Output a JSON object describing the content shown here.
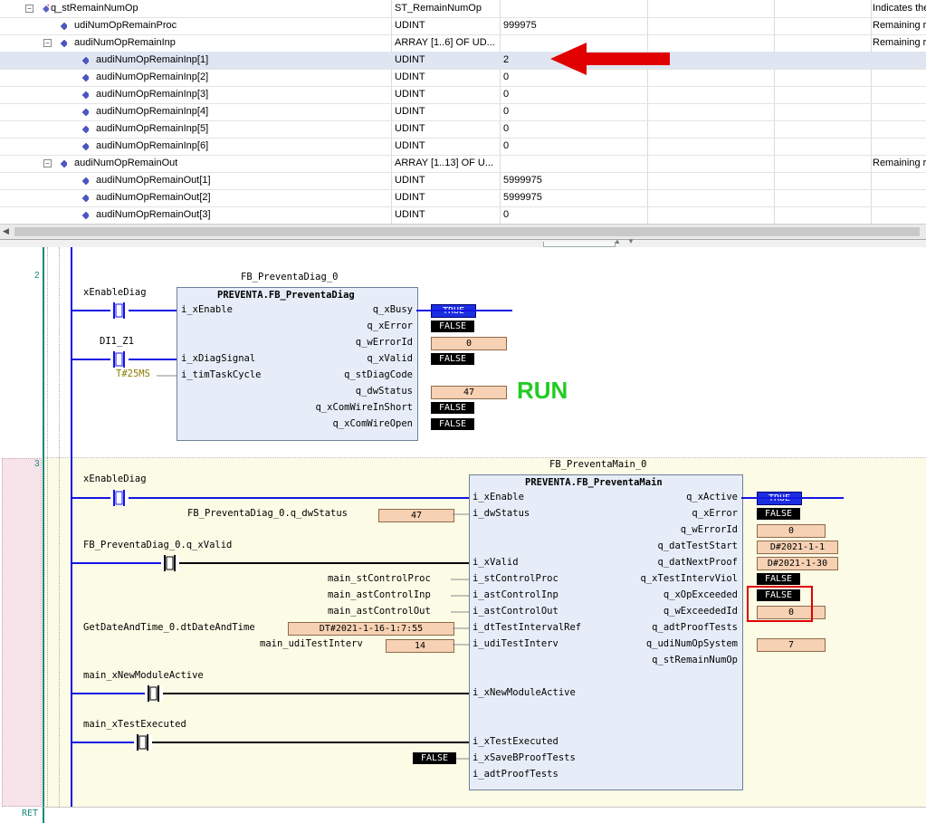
{
  "watch": {
    "rows": [
      {
        "name": "q_stRemainNumOp",
        "type": "ST_RemainNumOp",
        "value": "",
        "comment": "Indicates the",
        "level": 0,
        "expander": "minus",
        "icon": "struct"
      },
      {
        "name": "udiNumOpRemainProc",
        "type": "UDINT",
        "value": "999975",
        "comment": "Remaining r",
        "level": 1,
        "expander": "",
        "icon": "var"
      },
      {
        "name": "audiNumOpRemainInp",
        "type": "ARRAY [1..6] OF UD...",
        "value": "",
        "comment": "Remaining r",
        "level": 1,
        "expander": "minus",
        "icon": "var"
      },
      {
        "name": "audiNumOpRemainInp[1]",
        "type": "UDINT",
        "value": "2",
        "comment": "",
        "level": 2,
        "expander": "",
        "icon": "var",
        "selected": true
      },
      {
        "name": "audiNumOpRemainInp[2]",
        "type": "UDINT",
        "value": "0",
        "comment": "",
        "level": 2,
        "expander": "",
        "icon": "var"
      },
      {
        "name": "audiNumOpRemainInp[3]",
        "type": "UDINT",
        "value": "0",
        "comment": "",
        "level": 2,
        "expander": "",
        "icon": "var"
      },
      {
        "name": "audiNumOpRemainInp[4]",
        "type": "UDINT",
        "value": "0",
        "comment": "",
        "level": 2,
        "expander": "",
        "icon": "var"
      },
      {
        "name": "audiNumOpRemainInp[5]",
        "type": "UDINT",
        "value": "0",
        "comment": "",
        "level": 2,
        "expander": "",
        "icon": "var"
      },
      {
        "name": "audiNumOpRemainInp[6]",
        "type": "UDINT",
        "value": "0",
        "comment": "",
        "level": 2,
        "expander": "",
        "icon": "var"
      },
      {
        "name": "audiNumOpRemainOut",
        "type": "ARRAY [1..13] OF U...",
        "value": "",
        "comment": "Remaining r",
        "level": 1,
        "expander": "minus",
        "icon": "var"
      },
      {
        "name": "audiNumOpRemainOut[1]",
        "type": "UDINT",
        "value": "5999975",
        "comment": "",
        "level": 2,
        "expander": "",
        "icon": "var"
      },
      {
        "name": "audiNumOpRemainOut[2]",
        "type": "UDINT",
        "value": "5999975",
        "comment": "",
        "level": 2,
        "expander": "",
        "icon": "var"
      },
      {
        "name": "audiNumOpRemainOut[3]",
        "type": "UDINT",
        "value": "0",
        "comment": "",
        "level": 2,
        "expander": "",
        "icon": "var"
      }
    ]
  },
  "fbd": {
    "network2": {
      "number": "2",
      "instance": "FB_PreventaDiag_0",
      "type": "PREVENTA.FB_PreventaDiag",
      "var_enable": "xEnableDiag",
      "var_signal": "DI1_Z1",
      "const_cycle": "T#25MS",
      "inputs": [
        "i_xEnable",
        "i_xDiagSignal",
        "i_timTaskCycle"
      ],
      "outputs": [
        "q_xBusy",
        "q_xError",
        "q_wErrorId",
        "q_xValid",
        "q_stDiagCode",
        "q_dwStatus",
        "q_xComWireInShort",
        "q_xComWireOpen"
      ],
      "values": {
        "q_xBusy": "TRUE",
        "q_xError": "FALSE",
        "q_wErrorId": "0",
        "q_xValid": "FALSE",
        "q_dwStatus": "47",
        "q_xComWireInShort": "FALSE",
        "q_xComWireOpen": "FALSE"
      },
      "run_text": "RUN"
    },
    "network3": {
      "number": "3",
      "instance": "FB_PreventaMain_0",
      "type": "PREVENTA.FB_PreventaMain",
      "var_enable": "xEnableDiag",
      "var_dwstatus": "FB_PreventaDiag_0.q_dwStatus",
      "var_dwstatus_value": "47",
      "var_valid": "FB_PreventaDiag_0.q_xValid",
      "var_controlproc": "main_stControlProc",
      "var_controlinp": "main_astControlInp",
      "var_controlout": "main_astControlOut",
      "var_datetime": "GetDateAndTime_0.dtDateAndTime",
      "var_datetime_value": "DT#2021-1-16-1:7:55",
      "var_testinterv": "main_udiTestInterv",
      "var_testinterv_value": "14",
      "var_newmodule": "main_xNewModuleActive",
      "var_testexecuted": "main_xTestExecuted",
      "const_savebproof": "FALSE",
      "inputs": [
        "i_xEnable",
        "i_dwStatus",
        "i_xValid",
        "i_stControlProc",
        "i_astControlInp",
        "i_astControlOut",
        "i_dtTestIntervalRef",
        "i_udiTestInterv",
        "i_xNewModuleActive",
        "i_xTestExecuted",
        "i_xSaveBProofTests",
        "i_adtProofTests"
      ],
      "outputs": [
        "q_xActive",
        "q_xError",
        "q_wErrorId",
        "q_datTestStart",
        "q_datNextProof",
        "q_xTestIntervViol",
        "q_xOpExceeded",
        "q_wExceededId",
        "q_adtProofTests",
        "q_udiNumOpSystem",
        "q_stRemainNumOp"
      ],
      "values": {
        "q_xActive": "TRUE",
        "q_xError": "FALSE",
        "q_wErrorId": "0",
        "q_datTestStart": "D#2021-1-1",
        "q_datNextProof": "D#2021-1-30",
        "q_xTestIntervViol": "FALSE",
        "q_xOpExceeded": "FALSE",
        "q_wExceededId": "0",
        "q_udiNumOpSystem": "7"
      }
    },
    "ret_label": "RET"
  },
  "colors": {
    "wire_blue": "#1414e6",
    "wire_black": "#000000",
    "rail_teal": "#1a8a7a",
    "run_green": "#22cc22",
    "annotation_red": "#e00000",
    "fb_fill": "#e7edf8",
    "network3_bg": "#fbfbe6",
    "margin_pink": "#f7e3ea"
  }
}
